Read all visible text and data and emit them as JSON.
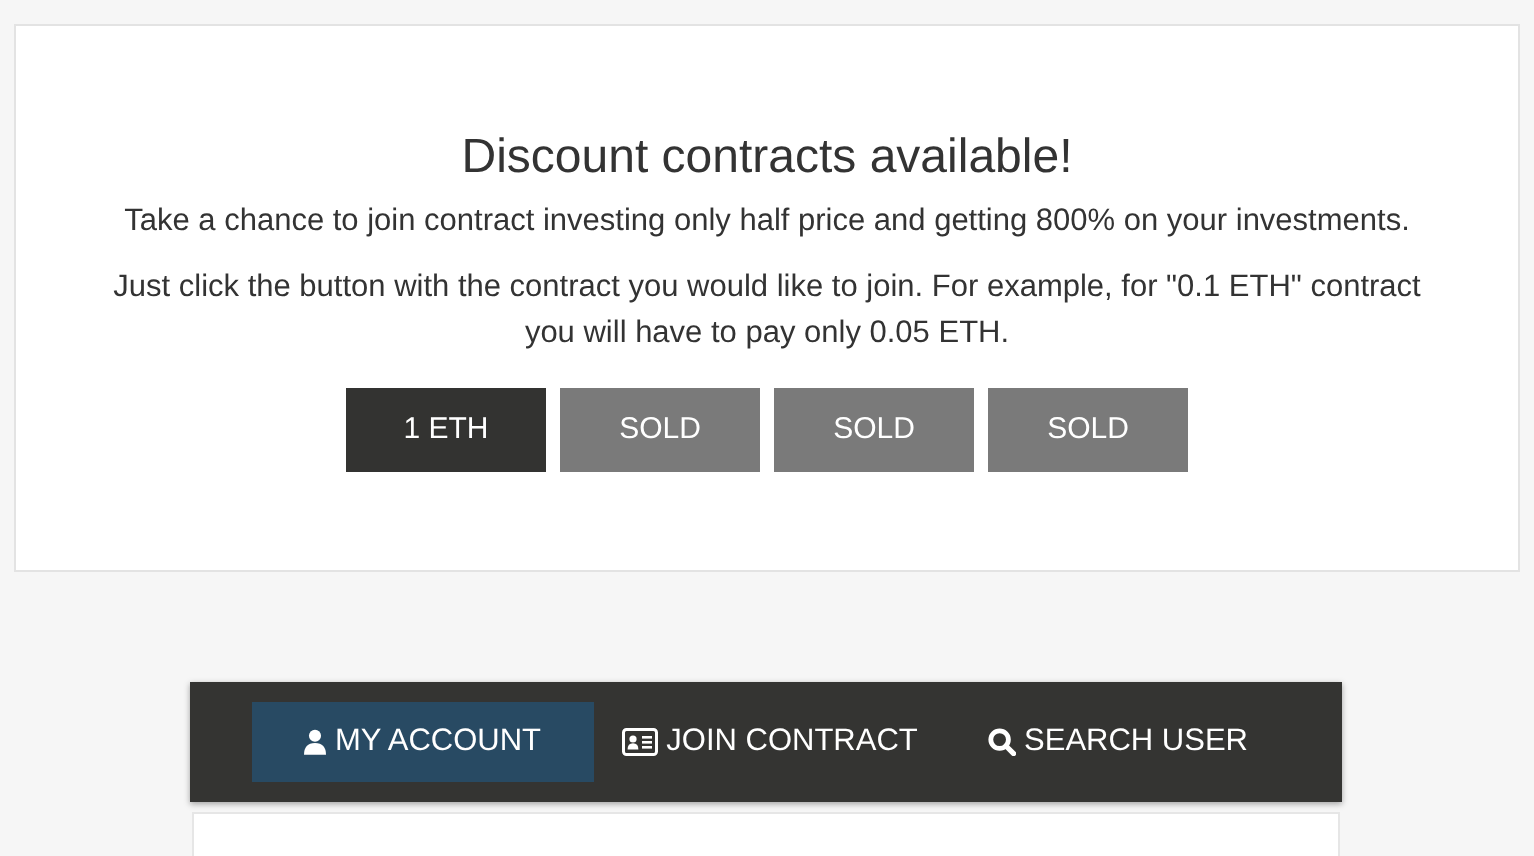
{
  "promo": {
    "title": "Discount contracts available!",
    "paragraphs": [
      "Take a chance to join contract investing only half price and getting 800% on your investments.",
      "Just click the button with the contract you would like to join. For example, for \"0.1 ETH\" contract you will have to pay only 0.05 ETH."
    ],
    "contracts": [
      {
        "label": "1 ETH",
        "sold": false
      },
      {
        "label": "SOLD",
        "sold": true
      },
      {
        "label": "SOLD",
        "sold": true
      },
      {
        "label": "SOLD",
        "sold": true
      }
    ]
  },
  "nav": {
    "tabs": [
      {
        "label": "MY ACCOUNT",
        "kind": "account",
        "selected": true
      },
      {
        "label": "JOIN CONTRACT",
        "kind": "contract",
        "selected": false
      },
      {
        "label": "SEARCH USER",
        "kind": "search",
        "selected": false
      }
    ]
  }
}
